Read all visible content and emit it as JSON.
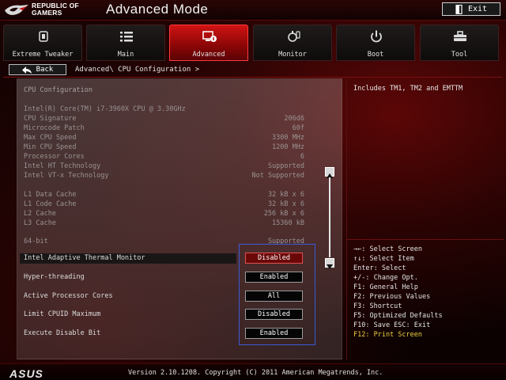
{
  "app": {
    "brand_line1": "REPUBLIC OF",
    "brand_line2": "GAMERS",
    "mode_title": "Advanced Mode",
    "exit_label": "Exit"
  },
  "tabs": [
    {
      "label": "Extreme Tweaker",
      "icon": "tweaker-icon",
      "active": false
    },
    {
      "label": "Main",
      "icon": "list-icon",
      "active": false
    },
    {
      "label": "Advanced",
      "icon": "advanced-icon",
      "active": true
    },
    {
      "label": "Monitor",
      "icon": "monitor-icon",
      "active": false
    },
    {
      "label": "Boot",
      "icon": "power-icon",
      "active": false
    },
    {
      "label": "Tool",
      "icon": "tool-icon",
      "active": false
    }
  ],
  "nav": {
    "back_label": "Back",
    "breadcrumb": "Advanced\\ CPU Configuration >"
  },
  "cpu": {
    "section_title": "CPU Configuration",
    "processor_name": "Intel(R) Core(TM) i7-3960X CPU @ 3.30GHz",
    "info": [
      {
        "label": "CPU Signature",
        "value": "206d6"
      },
      {
        "label": "Microcode Patch",
        "value": "60f"
      },
      {
        "label": "Max CPU Speed",
        "value": "3300 MHz"
      },
      {
        "label": "Min CPU Speed",
        "value": "1200 MHz"
      },
      {
        "label": "Processor Cores",
        "value": "6"
      },
      {
        "label": "Intel HT Technology",
        "value": "Supported"
      },
      {
        "label": "Intel VT-x Technology",
        "value": "Not Supported"
      }
    ],
    "cache": [
      {
        "label": "L1 Data Cache",
        "value": "32 kB x 6"
      },
      {
        "label": "L1 Code Cache",
        "value": "32 kB x 6"
      },
      {
        "label": "L2 Cache",
        "value": "256 kB x 6"
      },
      {
        "label": "L3 Cache",
        "value": "15360 kB"
      }
    ],
    "bit": {
      "label": "64-bit",
      "value": "Supported"
    }
  },
  "settings": [
    {
      "label": "Intel Adaptive Thermal Monitor",
      "value": "Disabled",
      "selected": true
    },
    {
      "label": "Hyper-threading",
      "value": "Enabled",
      "selected": false
    },
    {
      "label": "Active Processor Cores",
      "value": "All",
      "selected": false
    },
    {
      "label": "Limit CPUID Maximum",
      "value": "Disabled",
      "selected": false
    },
    {
      "label": "Execute Disable Bit",
      "value": "Enabled",
      "selected": false
    }
  ],
  "help": {
    "description": "Includes TM1, TM2 and EMTTM",
    "keys": [
      "→←: Select Screen",
      "↑↓: Select Item",
      "Enter: Select",
      "+/-: Change Opt.",
      "F1: General Help",
      "F2: Previous Values",
      "F3: Shortcut",
      "F5: Optimized Defaults",
      "F10: Save  ESC: Exit",
      "F12: Print Screen"
    ]
  },
  "footer": {
    "brand": "ASUS",
    "copyright": "Version 2.10.1208. Copyright (C) 2011 American Megatrends, Inc."
  },
  "colors": {
    "accent_red": "#d01313",
    "selection_red": "#6a0808",
    "highlight_yellow": "#f0d040",
    "focus_blue": "#3a5ad8"
  }
}
